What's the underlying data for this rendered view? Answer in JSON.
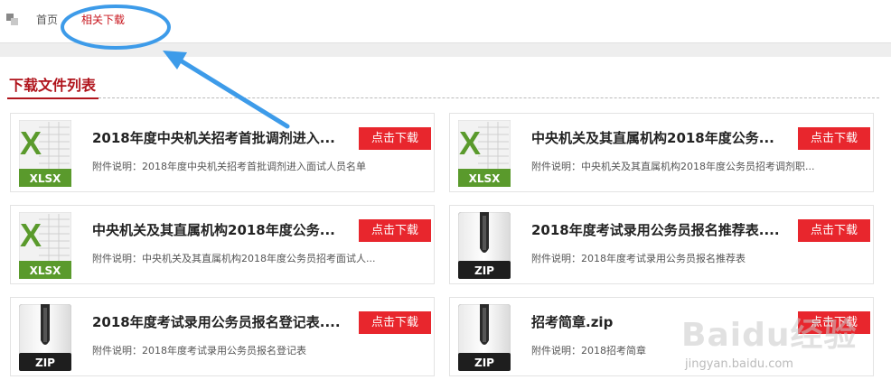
{
  "breadcrumb": {
    "home": "首页",
    "current": "相关下载"
  },
  "section": {
    "title": "下载文件列表"
  },
  "download_label": "点击下载",
  "files": [
    {
      "title": "2018年度中央机关招考首批调剂进入...",
      "desc": "附件说明：2018年度中央机关招考首批调剂进入面试人员名单",
      "icon": "xlsx-file-icon",
      "ext": "XLSX"
    },
    {
      "title": "中央机关及其直属机构2018年度公务...",
      "desc": "附件说明：中央机关及其直属机构2018年度公务员招考调剂职...",
      "icon": "xlsx-file-icon",
      "ext": "XLSX"
    },
    {
      "title": "中央机关及其直属机构2018年度公务...",
      "desc": "附件说明：中央机关及其直属机构2018年度公务员招考面试人...",
      "icon": "xlsx-file-icon",
      "ext": "XLSX"
    },
    {
      "title": "2018年度考试录用公务员报名推荐表....",
      "desc": "附件说明：2018年度考试录用公务员报名推荐表",
      "icon": "zip-file-icon",
      "ext": "ZIP"
    },
    {
      "title": "2018年度考试录用公务员报名登记表....",
      "desc": "附件说明：2018年度考试录用公务员报名登记表",
      "icon": "zip-file-icon",
      "ext": "ZIP"
    },
    {
      "title": "招考简章.zip",
      "desc": "附件说明：2018招考简章",
      "icon": "zip-file-icon",
      "ext": "ZIP"
    }
  ],
  "watermark": {
    "brand": "Baidu经验",
    "url": "jingyan.baidu.com"
  },
  "colors": {
    "accent": "#b0141c",
    "button": "#e8262d",
    "annotation": "#3d9be9",
    "excel_green": "#5a9a2c"
  }
}
